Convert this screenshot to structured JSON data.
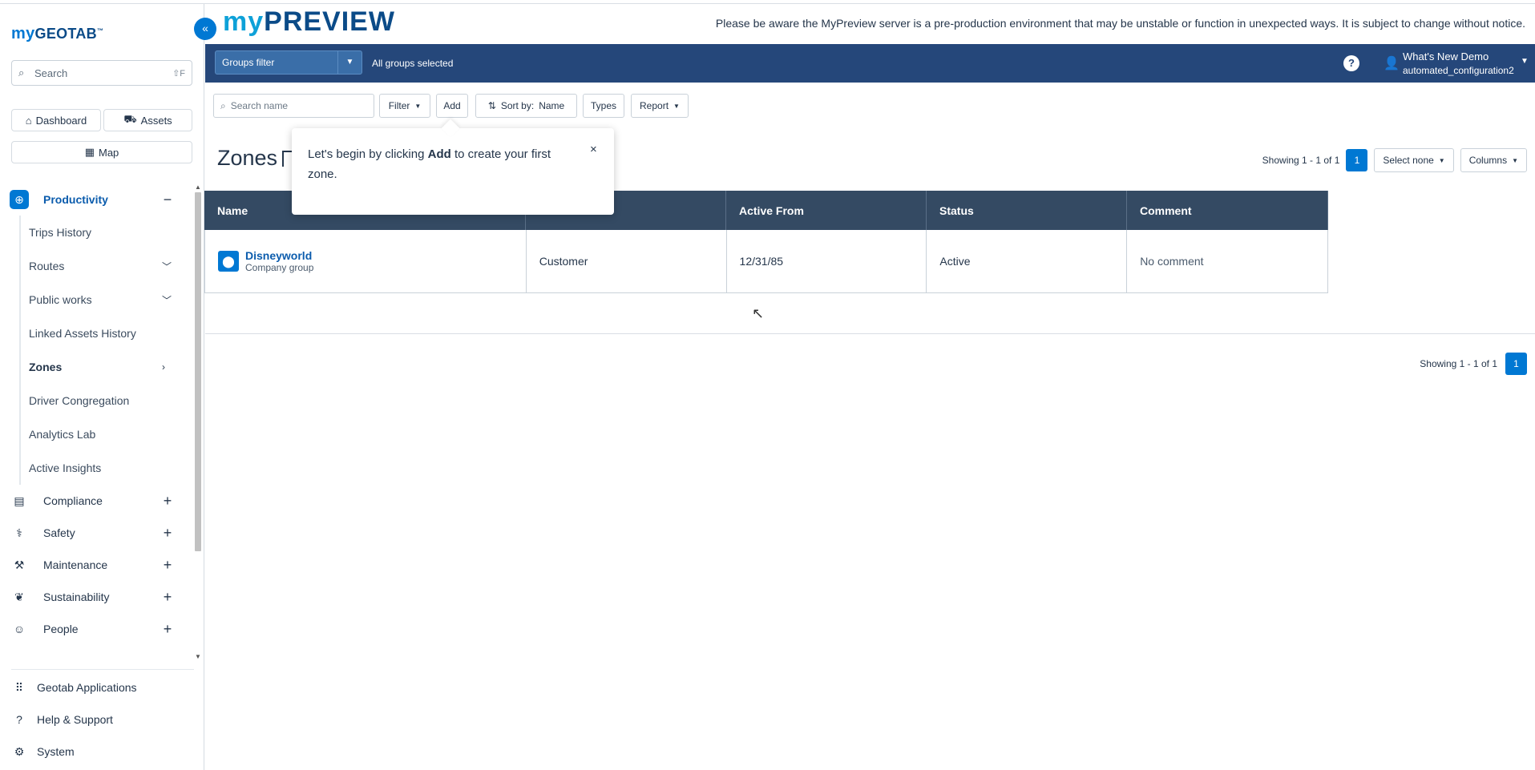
{
  "sidebar": {
    "logo_my": "my",
    "logo_rest": "GEOTAB",
    "logo_tm": "™",
    "collapse_icon": "«",
    "search_placeholder": "Search",
    "search_shortcut": "⇧F",
    "quick": {
      "dashboard": "Dashboard",
      "assets": "Assets",
      "map": "Map"
    },
    "sections": {
      "productivity": "Productivity",
      "compliance": "Compliance",
      "safety": "Safety",
      "maintenance": "Maintenance",
      "sustainability": "Sustainability",
      "people": "People"
    },
    "productivity_items": [
      "Trips History",
      "Routes",
      "Public works",
      "Linked Assets History",
      "Zones",
      "Driver Congregation",
      "Analytics Lab",
      "Active Insights"
    ],
    "bottom": {
      "apps": "Geotab Applications",
      "help": "Help & Support",
      "system": "System"
    }
  },
  "header": {
    "brand_my": "my",
    "brand_rest": "PREVIEW",
    "notice": "Please be aware the MyPreview server is a pre-production environment that may be unstable or function in unexpected ways. It is subject to change without notice.",
    "groups_filter": "Groups filter",
    "all_groups": "All groups selected",
    "help": "?",
    "user_name": "What's New Demo",
    "user_db": "automated_configuration2"
  },
  "toolbar": {
    "search_placeholder": "Search name",
    "filter": "Filter",
    "add": "Add",
    "sort_prefix": "Sort by:",
    "sort_value": "Name",
    "types": "Types",
    "report": "Report"
  },
  "page": {
    "title": "Zones",
    "tooltip_pre": "Let's begin by clicking ",
    "tooltip_bold": "Add",
    "tooltip_post": " to create your first zone.",
    "tooltip_close": "×",
    "showing": "Showing 1 - 1 of 1",
    "page_num": "1",
    "select_none": "Select none",
    "columns": "Columns"
  },
  "table": {
    "headers": [
      "Name",
      "",
      "Active From",
      "Status",
      "Comment"
    ],
    "rows": [
      {
        "name": "Disneyworld",
        "group": "Company group",
        "type": "Customer",
        "active_from": "12/31/85",
        "status": "Active",
        "comment": "No comment"
      }
    ]
  },
  "colors": {
    "accent": "#0078d3",
    "header_bar": "#25477a",
    "table_head": "#344a63"
  }
}
